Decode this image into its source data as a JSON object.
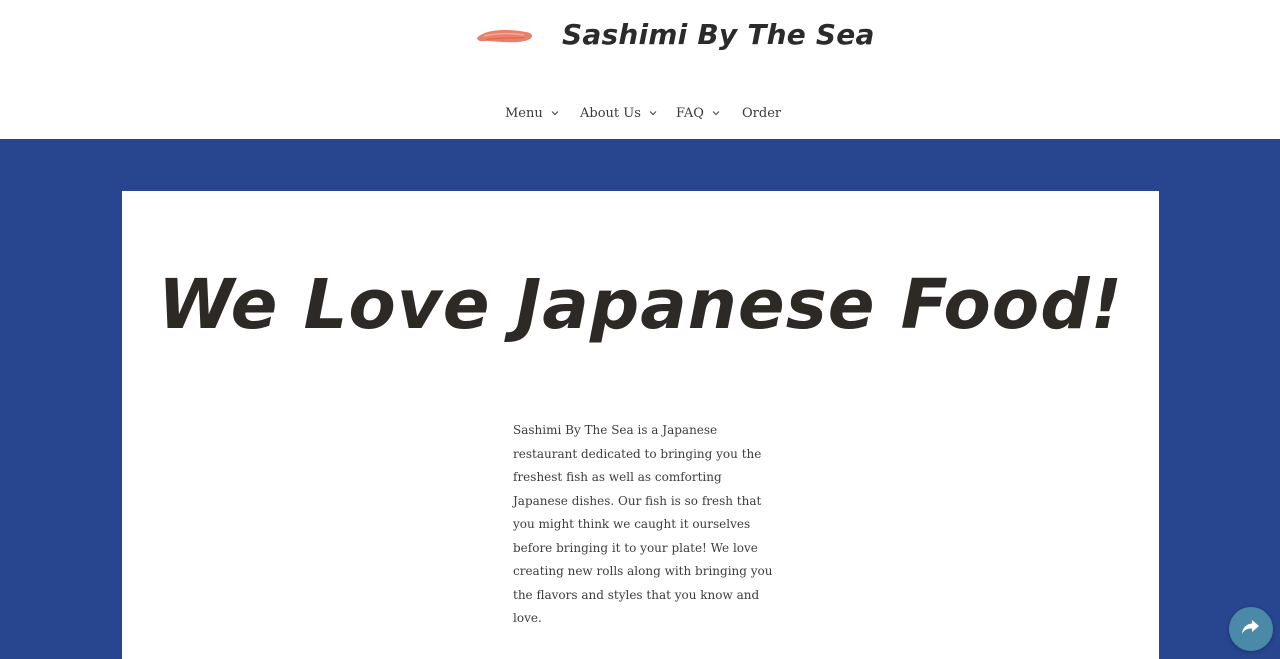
{
  "header": {
    "site_title": "Sashimi By The Sea",
    "logo_icon": "sashimi-slice-icon",
    "logo_color": "#e8806a"
  },
  "nav": {
    "items": [
      {
        "label": "Menu",
        "has_dropdown": true
      },
      {
        "label": "About Us",
        "has_dropdown": true
      },
      {
        "label": "FAQ",
        "has_dropdown": true
      },
      {
        "label": "Order",
        "has_dropdown": false
      }
    ]
  },
  "hero": {
    "background_color": "#27468f",
    "headline": "We Love Japanese Food!",
    "intro_text": "Sashimi By The Sea is a Japanese restaurant dedicated to bringing you the freshest fish as well as comforting Japanese dishes. Our fish is so fresh that you might think we caught it ourselves before bringing it to your plate! We love creating new rolls along with bringing you the flavors and styles that you know and love."
  },
  "share_button": {
    "icon": "share-arrow-icon",
    "color": "#4a8aa8"
  }
}
